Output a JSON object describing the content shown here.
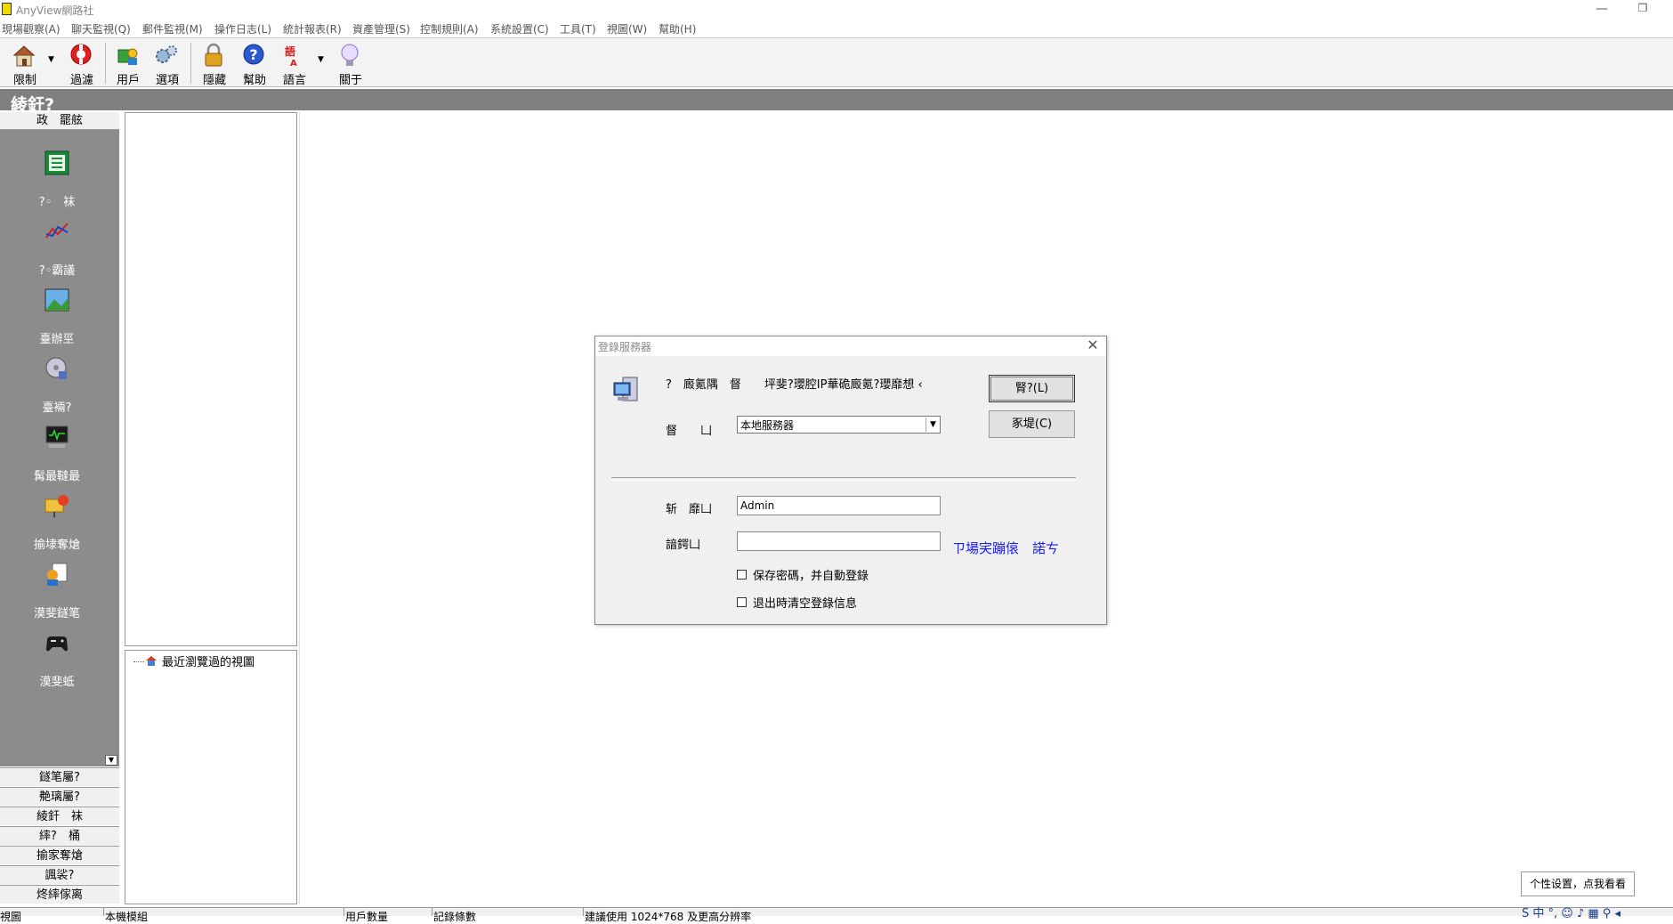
{
  "window": {
    "title": "AnyView網路社",
    "minimize_glyph": "—",
    "restore_glyph": "❐"
  },
  "menu": [
    "現場觀察(A)",
    "聊天監視(Q)",
    "郵件監視(M)",
    "操作日志(L)",
    "統計報表(R)",
    "資產管理(S)",
    "控制規則(A)",
    "系統設置(C)",
    "工具(T)",
    "視圖(W)",
    "幫助(H)"
  ],
  "toolbar": {
    "limit": "限制",
    "filter": "過濾",
    "users": "用戶",
    "options": "選項",
    "hide": "隱藏",
    "help": "幫助",
    "language": "語言",
    "about": "關于"
  },
  "section": {
    "title": "綾釬?"
  },
  "sidebar": {
    "header": "政　罷舷",
    "items": [
      "?◦　袜",
      "?◦霸議",
      "臺辦巠",
      "臺裲?",
      "髯最韃最",
      "揄埭奪熗",
      "漠斐鐩笔",
      "漠斐蚳"
    ],
    "bottom": [
      "鐩笔屬?",
      "艴璃屬?",
      "綾釬　袜",
      "繂?　桶",
      "揄家奪熗",
      "諷裟?",
      "炵繂傢离"
    ]
  },
  "tree": {
    "recent_views": "最近瀏覽過的視圖"
  },
  "dialog": {
    "title": "登錄服務器",
    "message": "?　廄氪隅　督　　坪斐?瓔腔IP華硊廄氪?瓔靡想 ‹",
    "server_label": "督　　凵",
    "server_value": "本地服務器",
    "ok_label": "腎?(L)",
    "cancel_label": "豖堤(C)",
    "user_label": "斩　靡凵",
    "username_value": "Admin",
    "password_label": "諳鍔凵",
    "link_text": "ㄗ場宎蹦偯　諾ㄘ",
    "save_password": "保存密碼，并自動登錄",
    "clear_on_exit": "退出時清空登錄信息"
  },
  "statusbar": {
    "view": "視圖",
    "local": "本機模組",
    "user_count": "用戶數量",
    "records": "記錄條數",
    "resolution": "建議使用 1024*768 及更高分辨率"
  },
  "tray": {
    "tooltip": "个性设置，点我看看",
    "icons": "S 中 °, ☺ ♪ ▦ ⚲ ◂"
  },
  "colors": {
    "sidebar_bg": "#8c8c8c",
    "section_bg": "#808080",
    "link": "#1a1aff"
  }
}
